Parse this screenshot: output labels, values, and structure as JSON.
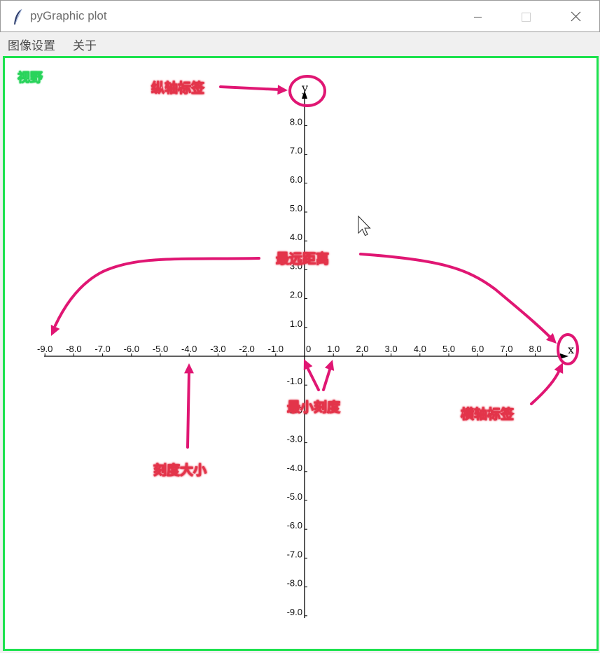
{
  "window": {
    "title": "pyGraphic plot"
  },
  "menu": {
    "items": [
      "图像设置",
      "关于"
    ]
  },
  "canvas": {
    "viewport_label": "视野",
    "border_color": "#1de24e"
  },
  "annotations": {
    "y_axis_label": "纵轴标签",
    "max_distance": "最远距离",
    "min_tick": "最小刻度",
    "x_axis_label": "横轴标签",
    "tick_size": "刻度大小",
    "color": "#e01673"
  },
  "chart_data": {
    "type": "axes",
    "xlabel": "x",
    "ylabel": "y",
    "origin_label": "0",
    "xlim": [
      -9.0,
      8.0
    ],
    "ylim": [
      -9.0,
      8.0
    ],
    "x_ticks": [
      "-9.0",
      "-8.0",
      "-7.0",
      "-6.0",
      "-5.0",
      "-4.0",
      "-3.0",
      "-2.0",
      "-1.0",
      "1.0",
      "2.0",
      "3.0",
      "4.0",
      "5.0",
      "6.0",
      "7.0",
      "8.0"
    ],
    "y_ticks": [
      "8.0",
      "7.0",
      "6.0",
      "5.0",
      "4.0",
      "3.0",
      "2.0",
      "1.0",
      "-1.0",
      "-2.0",
      "-3.0",
      "-4.0",
      "-5.0",
      "-6.0",
      "-7.0",
      "-8.0",
      "-9.0"
    ],
    "grid": false
  }
}
